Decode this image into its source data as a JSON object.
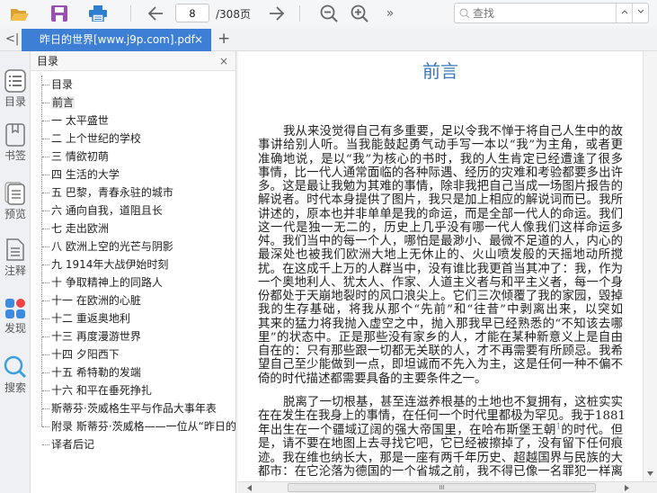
{
  "toolbar": {
    "page_current": "8",
    "page_total": "/308页",
    "more": "»",
    "search_placeholder": "查找",
    "search_prev": "^",
    "search_next": "v"
  },
  "tabs": {
    "collapse": "<|",
    "active_tab": "昨日的世界[www.j9p.com].pdf",
    "close": "×",
    "add": "+"
  },
  "rail": [
    {
      "label": "目录"
    },
    {
      "label": "书签"
    },
    {
      "label": "预览"
    },
    {
      "label": "注释"
    },
    {
      "label": "发现"
    },
    {
      "label": "搜索"
    }
  ],
  "toc": {
    "title": "目录",
    "close": "×",
    "items": [
      "目录",
      "前言",
      "一 太平盛世",
      "二 上个世纪的学校",
      "三 情欲初萌",
      "四 生活的大学",
      "五 巴黎，青春永驻的城市",
      "六 通向自我，道阻且长",
      "七 走出欧洲",
      "八 欧洲上空的光芒与阴影",
      "九 1914年大战伊始时刻",
      "十 争取精神上的同路人",
      "十一 在欧洲的心脏",
      "十二 重返奥地利",
      "十三 再度漫游世界",
      "十四 夕阳西下",
      "十五 希特勒的发端",
      "十六 和平在垂死挣扎",
      "斯蒂芬·茨威格生平与作品大事年表",
      "附录 斯蒂芬·茨威格——一位从“昨日的世界”",
      "译者后记"
    ]
  },
  "document": {
    "title": "前言",
    "paragraph1": [
      "我从来没觉得自己有多重要，足以令我不惮于将自己人生中的故",
      "事讲给别人听。当我能鼓起勇气动手写一本以“我”为主角，或者更",
      "准确地说，是以“我”为核心的书时，我的人生肯定已经遭逢了很多",
      "事情，比一代人通常面临的各种际遇、经历的灾难和考验都要多出许",
      "多。这是最让我勉为其难的事情，除非我把自己当成一场图片报告的",
      "解说者。时代本身提供了图片，我只是加上相应的解说词而已。我所",
      "讲述的，原本也并非单单是我的命运，而是全部一代人的命运。我们",
      "这一代是独一无二的，历史上几乎没有哪一代人像我们这样命运多",
      "舛。我们当中的每一个人，哪怕是最渺小、最微不足道的人，内心的",
      "最深处也被我们欧洲大地上无休止的、火山喷发般的天摇地动所搅",
      "扰。在这成千上万的人群当中，没有谁比我更首当其冲了：我，作为",
      "一个奥地利人、犹太人、作家、人道主义者与和平主义者，每一个身",
      "份都处于天崩地裂时的风口浪尖上。它们三次倾覆了我的家园，毁掉",
      "我的生存基础，将我从那个“先前”和“往昔”中剥离出来，以突如",
      "其来的猛力将我抛入虚空之中，抛入那我早已经熟悉的“不知该去哪",
      "里”的状态中。正是那些没有家乡的人，才能在某种新意义上是自由",
      "自在的：只有那些跟一切都无关联的人，才不再需要有所顾忌。我希",
      "望自己至少能做到一点，即坦诚而不先入为主，这是任何一种不偏不",
      "倚的时代描述都需要具备的主要条件之一。"
    ],
    "paragraph2": {
      "line1": "脱离了一切根基，甚至连滋养根基的土地也不复拥有，这桩实实",
      "line2": "在在发生在我身上的事情，在任何一个时代里都极为罕见。我于1881",
      "line3_a": "年出生在一个疆域辽阔的强大帝国里，在哈布斯堡王朝",
      "line3_footnote": "1",
      "line3_b": "的时代。但",
      "line4": "是，请不要在地图上去寻找它吧，它已经被擦掉了，没有留下任何痕",
      "line5": "迹。我在维也纳长大，那是一座有两千年历史、超越国界与民族的大",
      "line6": "都市：在它沦落为德国的一个省城之前，我不得已像一名罪犯一样离"
    }
  },
  "scrollbar": {
    "grip": "III"
  },
  "colors": {
    "accent": "#3d7fd5",
    "title": "#3a78b8"
  }
}
